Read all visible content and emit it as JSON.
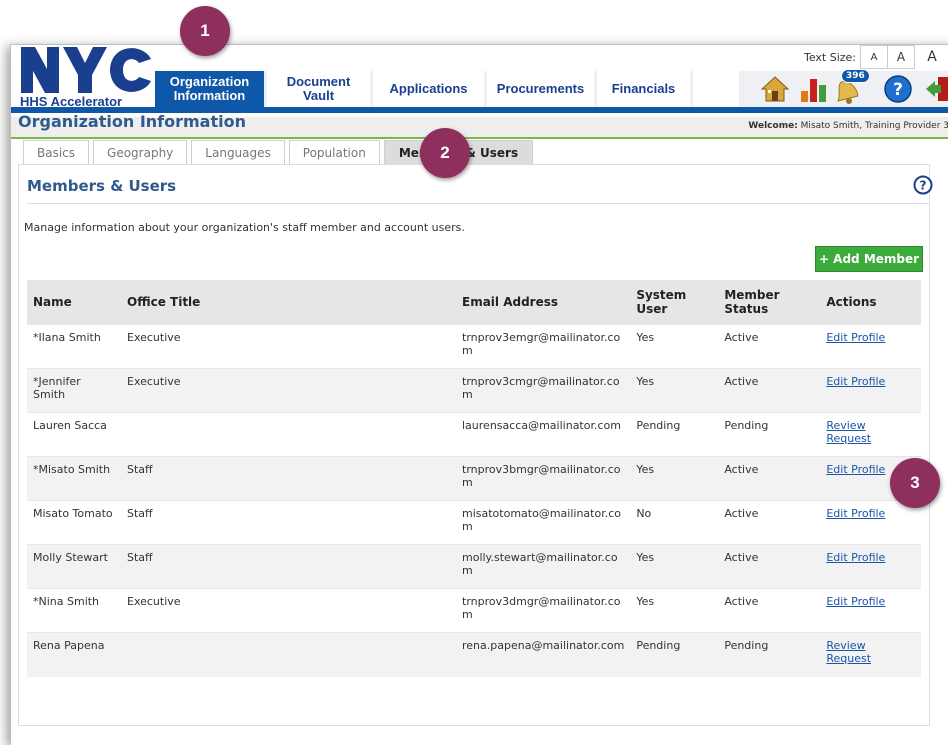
{
  "brand": {
    "logo_text": "NYC",
    "sub": "HHS Accelerator",
    "color": "#1a3f8f"
  },
  "text_size": {
    "label": "Text Size:",
    "small": "A",
    "medium": "A",
    "large": "A"
  },
  "nav": [
    {
      "line1": "Organization",
      "line2": "Information"
    },
    {
      "line1": "Document",
      "line2": "Vault"
    },
    {
      "line1": "Applications",
      "line2": ""
    },
    {
      "line1": "Procurements",
      "line2": ""
    },
    {
      "line1": "Financials",
      "line2": ""
    }
  ],
  "header_icons": {
    "home": "home-icon",
    "reports": "bar-chart-icon",
    "alerts": "bell-icon",
    "alerts_count": "396",
    "help": "help-icon",
    "logout": "logout-icon"
  },
  "welcome": {
    "label": "Welcome:",
    "user": "Misato Smith, Training Provider 3"
  },
  "page_title": "Organization Information",
  "subtabs": [
    "Basics",
    "Geography",
    "Languages",
    "Population",
    "Members & Users"
  ],
  "panel": {
    "title": "Members & Users",
    "description": "Manage information about your organization's staff member and account users.",
    "add_button": "+ Add Member"
  },
  "table": {
    "headers": {
      "name": "Name",
      "office_title": "Office Title",
      "email": "Email Address",
      "system_user": "System User",
      "member_status": "Member Status",
      "actions": "Actions"
    },
    "rows": [
      {
        "name": "*Ilana Smith",
        "title": "Executive",
        "email": "trnprov3emgr@mailinator.com",
        "system": "Yes",
        "status": "Active",
        "action1": "Edit Profile",
        "action2": ""
      },
      {
        "name": "*Jennifer Smith",
        "title": "Executive",
        "email": "trnprov3cmgr@mailinator.com",
        "system": "Yes",
        "status": "Active",
        "action1": "Edit Profile",
        "action2": ""
      },
      {
        "name": "Lauren Sacca",
        "title": "",
        "email": "laurensacca@mailinator.com",
        "system": "Pending",
        "status": "Pending",
        "action1": "Review",
        "action2": "Request"
      },
      {
        "name": "*Misato Smith",
        "title": "Staff",
        "email": "trnprov3bmgr@mailinator.com",
        "system": "Yes",
        "status": "Active",
        "action1": "Edit Profile",
        "action2": ""
      },
      {
        "name": "Misato Tomato",
        "title": "Staff",
        "email": "misatotomato@mailinator.com",
        "system": "No",
        "status": "Active",
        "action1": "Edit Profile",
        "action2": ""
      },
      {
        "name": "Molly Stewart",
        "title": "Staff",
        "email": "molly.stewart@mailinator.com",
        "system": "Yes",
        "status": "Active",
        "action1": "Edit Profile",
        "action2": ""
      },
      {
        "name": "*Nina Smith",
        "title": "Executive",
        "email": "trnprov3dmgr@mailinator.com",
        "system": "Yes",
        "status": "Active",
        "action1": "Edit Profile",
        "action2": ""
      },
      {
        "name": "Rena Papena",
        "title": "",
        "email": "rena.papena@mailinator.com",
        "system": "Pending",
        "status": "Pending",
        "action1": "Review",
        "action2": "Request"
      }
    ]
  },
  "callouts": [
    "1",
    "2",
    "3"
  ],
  "colors": {
    "primary": "#0f57a8",
    "heading": "#305a8c",
    "add_button": "#3cab3c",
    "callout": "#8e2f5e",
    "accent_line": "#7ab648"
  }
}
